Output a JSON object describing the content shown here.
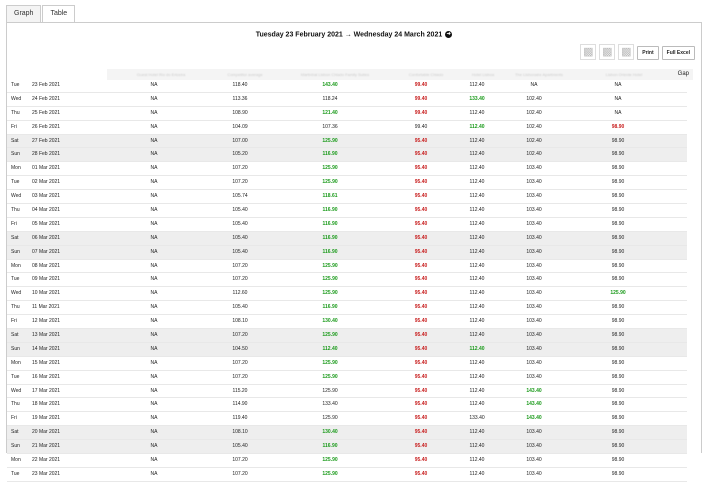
{
  "tabs": [
    {
      "label": "Graph"
    },
    {
      "label": "Table"
    }
  ],
  "date_range": "Tuesday 23 February 2021 → Wednesday 24 March 2021",
  "toolbar": {
    "print_label": "Print",
    "excel_label": "Full Excel"
  },
  "columns": [
    "Guest Hotel Rio do Ericeira",
    "Competitor average",
    "Martinhal Lisbon Chiado Family Suites",
    "Confortable Chiado",
    "Hotel Lisboa",
    "The Lisbonaire Apartments",
    "Lisbon Oriente Hotel"
  ],
  "gap_label": "Gap",
  "colors": {
    "green": "#1a9a1a",
    "red": "#c81e1e",
    "weekend_bg": "#eeeeee"
  },
  "rows": [
    {
      "day": "Tue",
      "date": "23 Feb 2021",
      "weekend": false,
      "cells": [
        {
          "v": "NA"
        },
        {
          "v": "118.40"
        },
        {
          "v": "143.40",
          "c": "green"
        },
        {
          "v": "99.40",
          "c": "red"
        },
        {
          "v": "112.40"
        },
        {
          "v": "NA"
        },
        {
          "v": "NA"
        }
      ]
    },
    {
      "day": "Wed",
      "date": "24 Feb 2021",
      "weekend": false,
      "cells": [
        {
          "v": "NA"
        },
        {
          "v": "113.36"
        },
        {
          "v": "118.24"
        },
        {
          "v": "99.40",
          "c": "red"
        },
        {
          "v": "133.40",
          "c": "green"
        },
        {
          "v": "102.40"
        },
        {
          "v": "NA"
        }
      ]
    },
    {
      "day": "Thu",
      "date": "25 Feb 2021",
      "weekend": false,
      "cells": [
        {
          "v": "NA"
        },
        {
          "v": "108.90"
        },
        {
          "v": "121.40",
          "c": "green"
        },
        {
          "v": "99.40",
          "c": "red"
        },
        {
          "v": "112.40"
        },
        {
          "v": "102.40"
        },
        {
          "v": "NA"
        }
      ]
    },
    {
      "day": "Fri",
      "date": "26 Feb 2021",
      "weekend": false,
      "cells": [
        {
          "v": "NA"
        },
        {
          "v": "104.09"
        },
        {
          "v": "107.36"
        },
        {
          "v": "99.40"
        },
        {
          "v": "112.40",
          "c": "green"
        },
        {
          "v": "102.40"
        },
        {
          "v": "98.90",
          "c": "red"
        }
      ]
    },
    {
      "day": "Sat",
      "date": "27 Feb 2021",
      "weekend": true,
      "cells": [
        {
          "v": "NA"
        },
        {
          "v": "107.00"
        },
        {
          "v": "125.90",
          "c": "green"
        },
        {
          "v": "95.40",
          "c": "red"
        },
        {
          "v": "112.40"
        },
        {
          "v": "102.40"
        },
        {
          "v": "98.90"
        }
      ]
    },
    {
      "day": "Sun",
      "date": "28 Feb 2021",
      "weekend": true,
      "cells": [
        {
          "v": "NA"
        },
        {
          "v": "105.20"
        },
        {
          "v": "116.90",
          "c": "green"
        },
        {
          "v": "95.40",
          "c": "red"
        },
        {
          "v": "112.40"
        },
        {
          "v": "102.40"
        },
        {
          "v": "98.90"
        }
      ]
    },
    {
      "day": "Mon",
      "date": "01 Mar 2021",
      "weekend": false,
      "cells": [
        {
          "v": "NA"
        },
        {
          "v": "107.20"
        },
        {
          "v": "125.90",
          "c": "green"
        },
        {
          "v": "95.40",
          "c": "red"
        },
        {
          "v": "112.40"
        },
        {
          "v": "103.40"
        },
        {
          "v": "98.90"
        }
      ]
    },
    {
      "day": "Tue",
      "date": "02 Mar 2021",
      "weekend": false,
      "cells": [
        {
          "v": "NA"
        },
        {
          "v": "107.20"
        },
        {
          "v": "125.90",
          "c": "green"
        },
        {
          "v": "95.40",
          "c": "red"
        },
        {
          "v": "112.40"
        },
        {
          "v": "103.40"
        },
        {
          "v": "98.90"
        }
      ]
    },
    {
      "day": "Wed",
      "date": "03 Mar 2021",
      "weekend": false,
      "cells": [
        {
          "v": "NA"
        },
        {
          "v": "105.74"
        },
        {
          "v": "118.61",
          "c": "green"
        },
        {
          "v": "95.40",
          "c": "red"
        },
        {
          "v": "112.40"
        },
        {
          "v": "103.40"
        },
        {
          "v": "98.90"
        }
      ]
    },
    {
      "day": "Thu",
      "date": "04 Mar 2021",
      "weekend": false,
      "cells": [
        {
          "v": "NA"
        },
        {
          "v": "105.40"
        },
        {
          "v": "116.90",
          "c": "green"
        },
        {
          "v": "95.40",
          "c": "red"
        },
        {
          "v": "112.40"
        },
        {
          "v": "103.40"
        },
        {
          "v": "98.90"
        }
      ]
    },
    {
      "day": "Fri",
      "date": "05 Mar 2021",
      "weekend": false,
      "cells": [
        {
          "v": "NA"
        },
        {
          "v": "105.40"
        },
        {
          "v": "116.90",
          "c": "green"
        },
        {
          "v": "95.40",
          "c": "red"
        },
        {
          "v": "112.40"
        },
        {
          "v": "103.40"
        },
        {
          "v": "98.90"
        }
      ]
    },
    {
      "day": "Sat",
      "date": "06 Mar 2021",
      "weekend": true,
      "cells": [
        {
          "v": "NA"
        },
        {
          "v": "105.40"
        },
        {
          "v": "116.90",
          "c": "green"
        },
        {
          "v": "95.40",
          "c": "red"
        },
        {
          "v": "112.40"
        },
        {
          "v": "103.40"
        },
        {
          "v": "98.90"
        }
      ]
    },
    {
      "day": "Sun",
      "date": "07 Mar 2021",
      "weekend": true,
      "cells": [
        {
          "v": "NA"
        },
        {
          "v": "105.40"
        },
        {
          "v": "116.90",
          "c": "green"
        },
        {
          "v": "95.40",
          "c": "red"
        },
        {
          "v": "112.40"
        },
        {
          "v": "103.40"
        },
        {
          "v": "98.90"
        }
      ]
    },
    {
      "day": "Mon",
      "date": "08 Mar 2021",
      "weekend": false,
      "cells": [
        {
          "v": "NA"
        },
        {
          "v": "107.20"
        },
        {
          "v": "125.90",
          "c": "green"
        },
        {
          "v": "95.40",
          "c": "red"
        },
        {
          "v": "112.40"
        },
        {
          "v": "103.40"
        },
        {
          "v": "98.90"
        }
      ]
    },
    {
      "day": "Tue",
      "date": "09 Mar 2021",
      "weekend": false,
      "cells": [
        {
          "v": "NA"
        },
        {
          "v": "107.20"
        },
        {
          "v": "125.90",
          "c": "green"
        },
        {
          "v": "95.40",
          "c": "red"
        },
        {
          "v": "112.40"
        },
        {
          "v": "103.40"
        },
        {
          "v": "98.90"
        }
      ]
    },
    {
      "day": "Wed",
      "date": "10 Mar 2021",
      "weekend": false,
      "cells": [
        {
          "v": "NA"
        },
        {
          "v": "112.60"
        },
        {
          "v": "125.90",
          "c": "green"
        },
        {
          "v": "95.40",
          "c": "red"
        },
        {
          "v": "112.40"
        },
        {
          "v": "103.40"
        },
        {
          "v": "125.90",
          "c": "green"
        }
      ]
    },
    {
      "day": "Thu",
      "date": "11 Mar 2021",
      "weekend": false,
      "cells": [
        {
          "v": "NA"
        },
        {
          "v": "105.40"
        },
        {
          "v": "116.90",
          "c": "green"
        },
        {
          "v": "95.40",
          "c": "red"
        },
        {
          "v": "112.40"
        },
        {
          "v": "103.40"
        },
        {
          "v": "98.90"
        }
      ]
    },
    {
      "day": "Fri",
      "date": "12 Mar 2021",
      "weekend": false,
      "cells": [
        {
          "v": "NA"
        },
        {
          "v": "108.10"
        },
        {
          "v": "130.40",
          "c": "green"
        },
        {
          "v": "95.40",
          "c": "red"
        },
        {
          "v": "112.40"
        },
        {
          "v": "103.40"
        },
        {
          "v": "98.90"
        }
      ]
    },
    {
      "day": "Sat",
      "date": "13 Mar 2021",
      "weekend": true,
      "cells": [
        {
          "v": "NA"
        },
        {
          "v": "107.20"
        },
        {
          "v": "125.90",
          "c": "green"
        },
        {
          "v": "95.40",
          "c": "red"
        },
        {
          "v": "112.40"
        },
        {
          "v": "103.40"
        },
        {
          "v": "98.90"
        }
      ]
    },
    {
      "day": "Sun",
      "date": "14 Mar 2021",
      "weekend": true,
      "cells": [
        {
          "v": "NA"
        },
        {
          "v": "104.50"
        },
        {
          "v": "112.40",
          "c": "green"
        },
        {
          "v": "95.40",
          "c": "red"
        },
        {
          "v": "112.40",
          "c": "green"
        },
        {
          "v": "103.40"
        },
        {
          "v": "98.90"
        }
      ]
    },
    {
      "day": "Mon",
      "date": "15 Mar 2021",
      "weekend": false,
      "cells": [
        {
          "v": "NA"
        },
        {
          "v": "107.20"
        },
        {
          "v": "125.90",
          "c": "green"
        },
        {
          "v": "95.40",
          "c": "red"
        },
        {
          "v": "112.40"
        },
        {
          "v": "103.40"
        },
        {
          "v": "98.90"
        }
      ]
    },
    {
      "day": "Tue",
      "date": "16 Mar 2021",
      "weekend": false,
      "cells": [
        {
          "v": "NA"
        },
        {
          "v": "107.20"
        },
        {
          "v": "125.90",
          "c": "green"
        },
        {
          "v": "95.40",
          "c": "red"
        },
        {
          "v": "112.40"
        },
        {
          "v": "103.40"
        },
        {
          "v": "98.90"
        }
      ]
    },
    {
      "day": "Wed",
      "date": "17 Mar 2021",
      "weekend": false,
      "cells": [
        {
          "v": "NA"
        },
        {
          "v": "115.20"
        },
        {
          "v": "125.90"
        },
        {
          "v": "95.40",
          "c": "red"
        },
        {
          "v": "112.40"
        },
        {
          "v": "143.40",
          "c": "green"
        },
        {
          "v": "98.90"
        }
      ]
    },
    {
      "day": "Thu",
      "date": "18 Mar 2021",
      "weekend": false,
      "cells": [
        {
          "v": "NA"
        },
        {
          "v": "114.90"
        },
        {
          "v": "133.40"
        },
        {
          "v": "95.40",
          "c": "red"
        },
        {
          "v": "112.40"
        },
        {
          "v": "143.40",
          "c": "green"
        },
        {
          "v": "98.90"
        }
      ]
    },
    {
      "day": "Fri",
      "date": "19 Mar 2021",
      "weekend": false,
      "cells": [
        {
          "v": "NA"
        },
        {
          "v": "119.40"
        },
        {
          "v": "125.90"
        },
        {
          "v": "95.40",
          "c": "red"
        },
        {
          "v": "133.40"
        },
        {
          "v": "143.40",
          "c": "green"
        },
        {
          "v": "98.90"
        }
      ]
    },
    {
      "day": "Sat",
      "date": "20 Mar 2021",
      "weekend": true,
      "cells": [
        {
          "v": "NA"
        },
        {
          "v": "108.10"
        },
        {
          "v": "130.40",
          "c": "green"
        },
        {
          "v": "95.40",
          "c": "red"
        },
        {
          "v": "112.40"
        },
        {
          "v": "103.40"
        },
        {
          "v": "98.90"
        }
      ]
    },
    {
      "day": "Sun",
      "date": "21 Mar 2021",
      "weekend": true,
      "cells": [
        {
          "v": "NA"
        },
        {
          "v": "105.40"
        },
        {
          "v": "116.90",
          "c": "green"
        },
        {
          "v": "95.40",
          "c": "red"
        },
        {
          "v": "112.40"
        },
        {
          "v": "103.40"
        },
        {
          "v": "98.90"
        }
      ]
    },
    {
      "day": "Mon",
      "date": "22 Mar 2021",
      "weekend": false,
      "cells": [
        {
          "v": "NA"
        },
        {
          "v": "107.20"
        },
        {
          "v": "125.90",
          "c": "green"
        },
        {
          "v": "95.40",
          "c": "red"
        },
        {
          "v": "112.40"
        },
        {
          "v": "103.40"
        },
        {
          "v": "98.90"
        }
      ]
    },
    {
      "day": "Tue",
      "date": "23 Mar 2021",
      "weekend": false,
      "cells": [
        {
          "v": "NA"
        },
        {
          "v": "107.20"
        },
        {
          "v": "125.90",
          "c": "green"
        },
        {
          "v": "95.40",
          "c": "red"
        },
        {
          "v": "112.40"
        },
        {
          "v": "103.40"
        },
        {
          "v": "98.90"
        }
      ]
    }
  ]
}
